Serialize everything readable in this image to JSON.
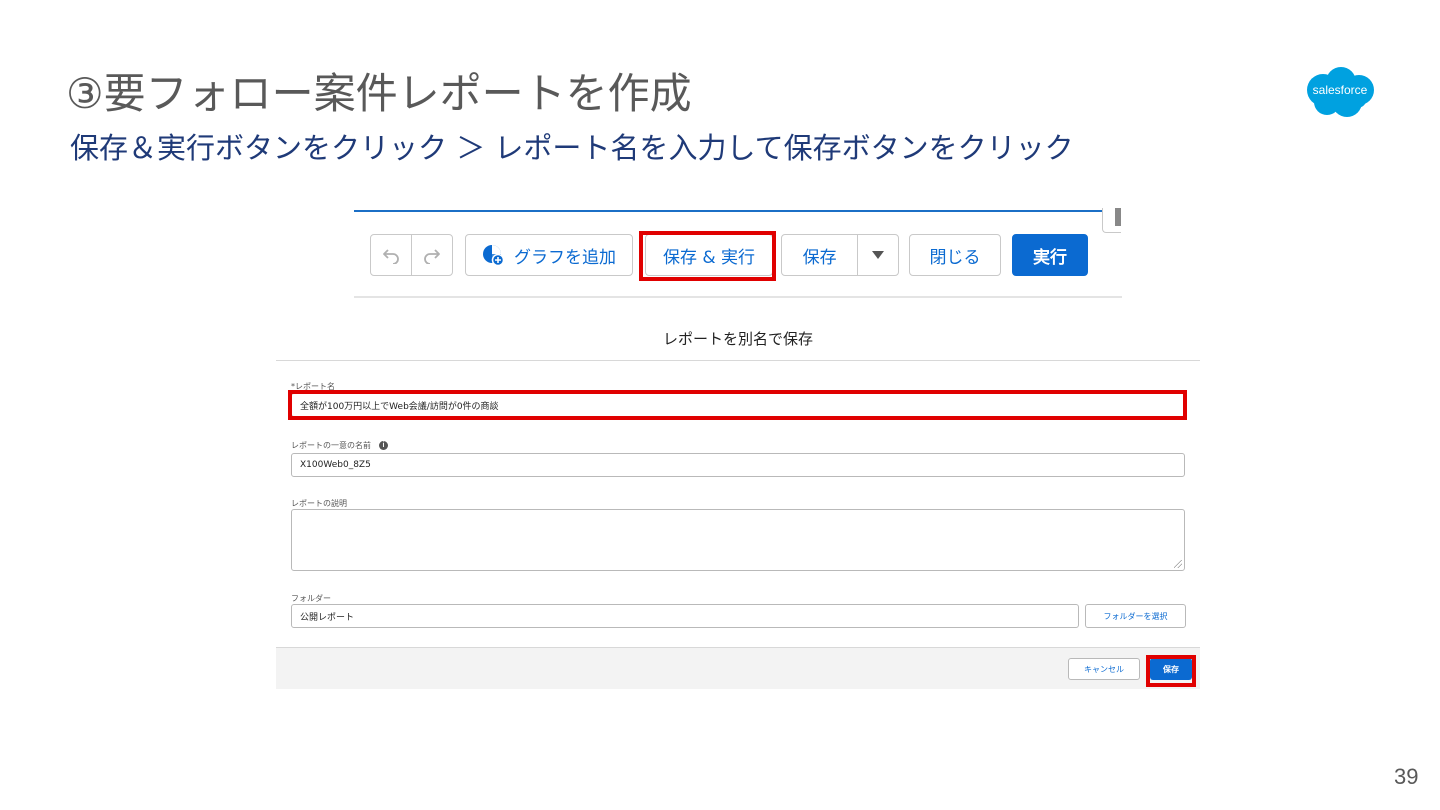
{
  "slide": {
    "title": "③要フォロー案件レポートを作成",
    "subtitle": "保存＆実行ボタンをクリック ＞ レポート名を入力して保存ボタンをクリック",
    "logo_text": "salesforce",
    "page_number": "39",
    "colors": {
      "title": "#595959",
      "subtitle": "#1f3a78",
      "brand": "#00a1e0",
      "highlight": "#e00000",
      "accent": "#0b6ad1"
    }
  },
  "toolbar": {
    "undo_icon": "undo-icon",
    "redo_icon": "redo-icon",
    "add_chart_icon": "chart-add-icon",
    "add_chart_label": "グラフを追加",
    "save_run_label": "保存 & 実行",
    "save_label": "保存",
    "save_menu_icon": "caret-down-icon",
    "close_label": "閉じる",
    "run_label": "実行"
  },
  "dialog": {
    "title": "レポートを別名で保存",
    "report_name_label": "*レポート名",
    "report_name_value": "全額が100万円以上でWeb会議/訪問が0件の商談",
    "unique_name_label": "レポートの一意の名前",
    "unique_name_value": "X100Web0_8Z5",
    "description_label": "レポートの説明",
    "description_value": "",
    "folder_label": "フォルダー",
    "folder_value": "公開レポート",
    "folder_select_label": "フォルダーを選択",
    "cancel_label": "キャンセル",
    "save_label": "保存"
  }
}
